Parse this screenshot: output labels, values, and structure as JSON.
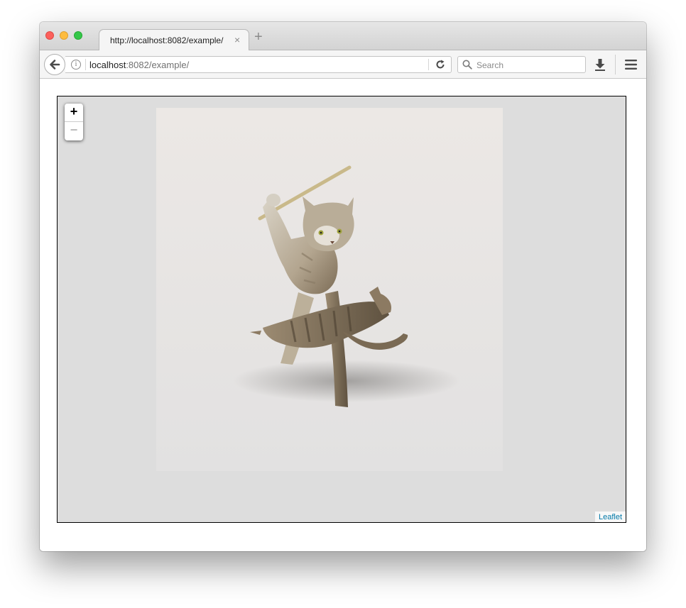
{
  "browser": {
    "tab": {
      "title": "http://localhost:8082/example/",
      "close_icon": "×"
    },
    "new_tab_icon": "+",
    "address": {
      "host": "localhost",
      "rest": ":8082/example/"
    },
    "search": {
      "placeholder": "Search"
    }
  },
  "map": {
    "zoom_in_label": "+",
    "zoom_out_label": "−",
    "attribution": "Leaflet",
    "image_description": "bronze figurine of a standing cat raising a stick while holding another cat",
    "colors": {
      "background": "#dddddd",
      "link": "#0078a8"
    }
  }
}
